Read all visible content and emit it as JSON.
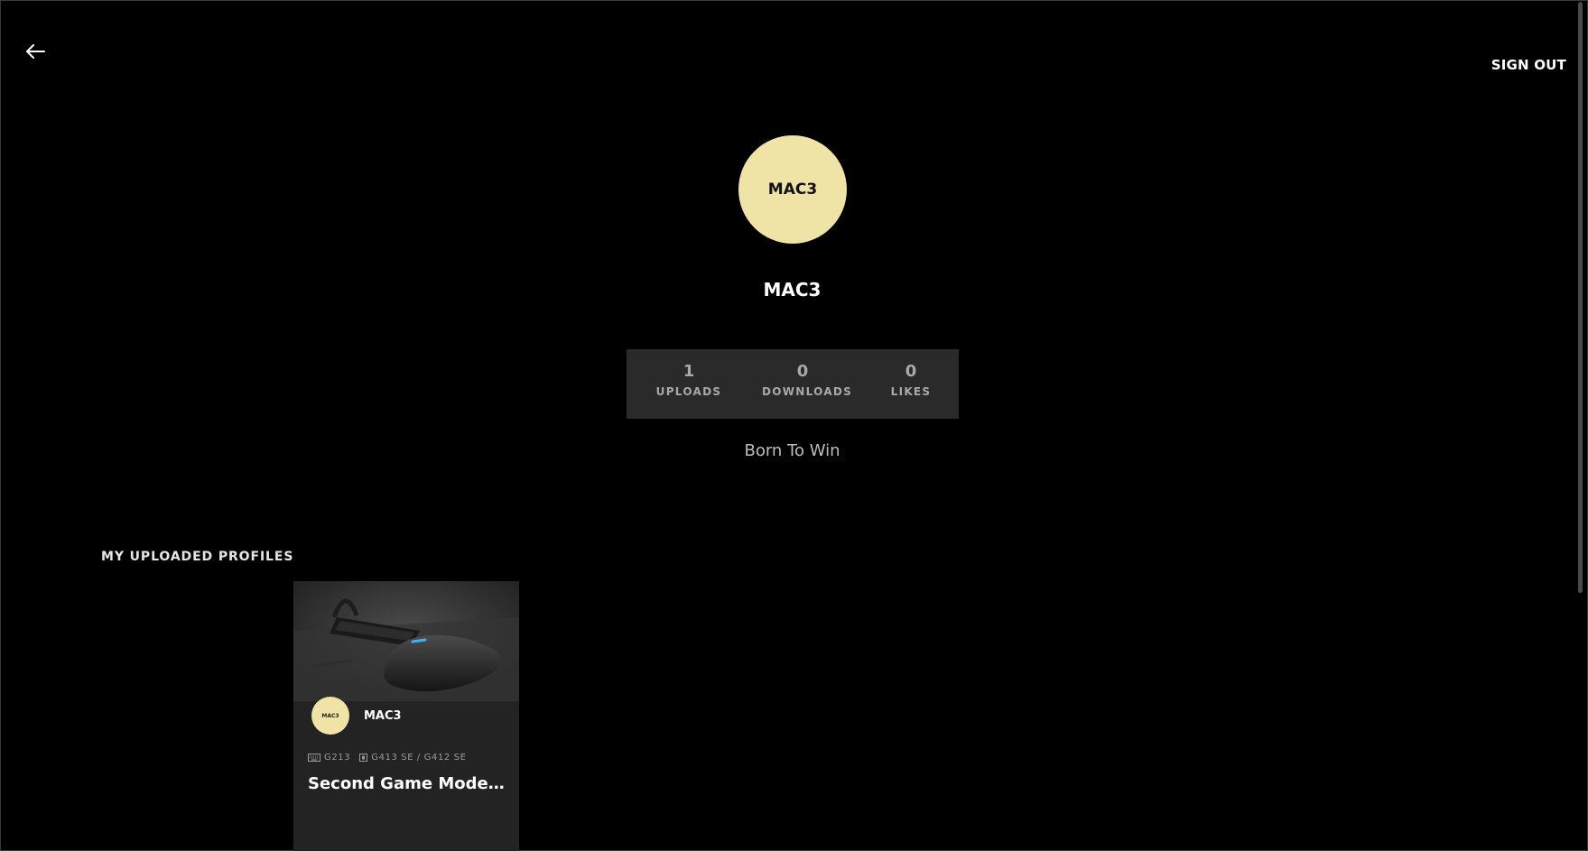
{
  "header": {
    "back_icon": "arrow-left-icon",
    "sign_out_label": "SIGN OUT"
  },
  "profile": {
    "avatar_text": "MAC3",
    "username": "MAC3",
    "bio": "Born To Win",
    "avatar_color": "#efe3a6"
  },
  "stats": [
    {
      "value": "1",
      "label": "UPLOADS"
    },
    {
      "value": "0",
      "label": "DOWNLOADS"
    },
    {
      "value": "0",
      "label": "LIKES"
    }
  ],
  "uploaded": {
    "section_title": "MY UPLOADED PROFILES",
    "cards": [
      {
        "author_avatar_text": "MAC3",
        "author": "MAC3",
        "devices": [
          {
            "icon": "keyboard-icon",
            "name": "G213"
          },
          {
            "icon": "mouse-icon",
            "name": "G413 SE / G412 SE"
          }
        ],
        "title": "Second Game Mode G..."
      }
    ]
  }
}
